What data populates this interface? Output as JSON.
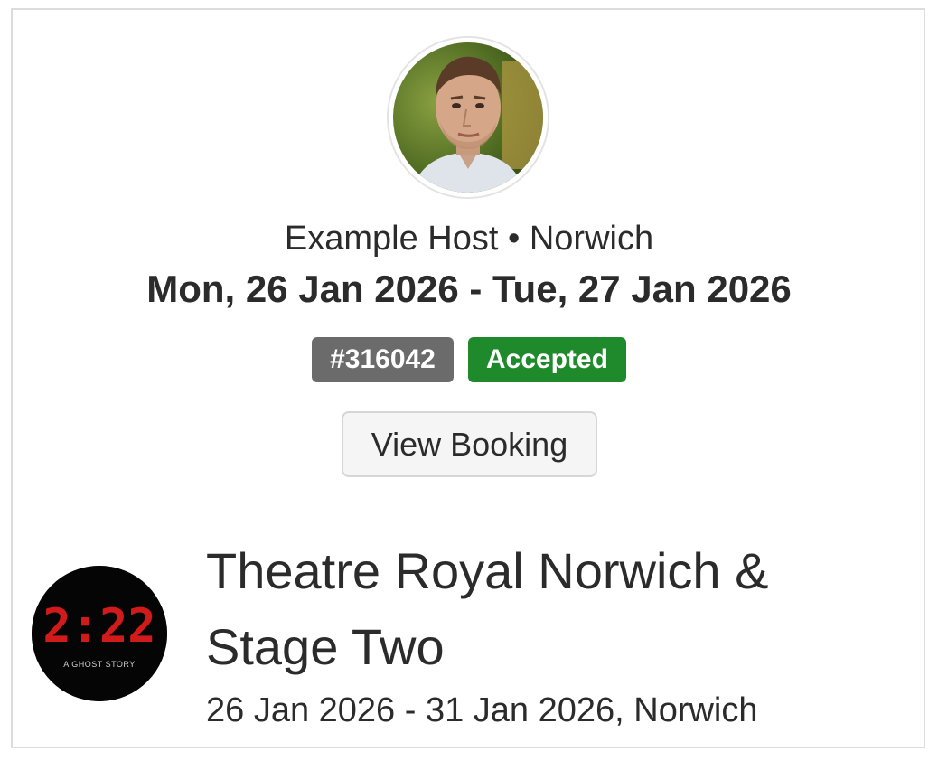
{
  "host": {
    "name": "Example Host",
    "separator": "•",
    "city": "Norwich",
    "avatar_icon": "host-photo"
  },
  "booking": {
    "date_range": "Mon, 26 Jan 2026 - Tue, 27 Jan 2026",
    "id_badge": "#316042",
    "status_badge": "Accepted",
    "view_button_label": "View Booking"
  },
  "event": {
    "logo_text": "2:22",
    "logo_subtext": "A GHOST STORY",
    "title": "Theatre Royal Norwich & Stage Two",
    "meta": "26 Jan 2026 - 31 Jan 2026, Norwich"
  },
  "colors": {
    "accepted": "#1f8a2b",
    "id_badge": "#6b6b6b",
    "logo_digits": "#d11a1a"
  }
}
